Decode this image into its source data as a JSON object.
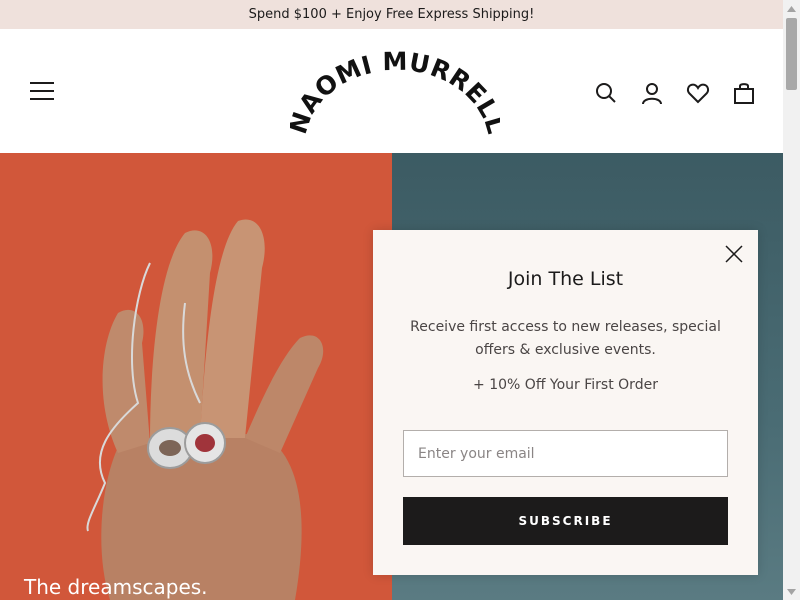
{
  "announcement": {
    "text": "Spend $100 + Enjoy Free Express Shipping!"
  },
  "header": {
    "logo_text": "NAOMI MURRELL",
    "icons": [
      "menu-icon",
      "search-icon",
      "account-icon",
      "wishlist-heart-icon",
      "cart-bag-icon"
    ]
  },
  "hero": {
    "caption": "The dreamscapes.",
    "colors": {
      "left_panel": "#d1573a",
      "right_panel": "#3c5b63"
    }
  },
  "popup": {
    "title": "Join The List",
    "description": "Receive first access to new releases, special offers & exclusive events.",
    "offer": "+ 10% Off Your First Order",
    "email_placeholder": "Enter your email",
    "email_value": "",
    "subscribe_label": "SUBSCRIBE",
    "close_icon": "close-icon"
  },
  "colors": {
    "accent_bar": "#efe1dc",
    "button_dark": "#1c1b1b",
    "popup_bg": "#faf6f3"
  }
}
